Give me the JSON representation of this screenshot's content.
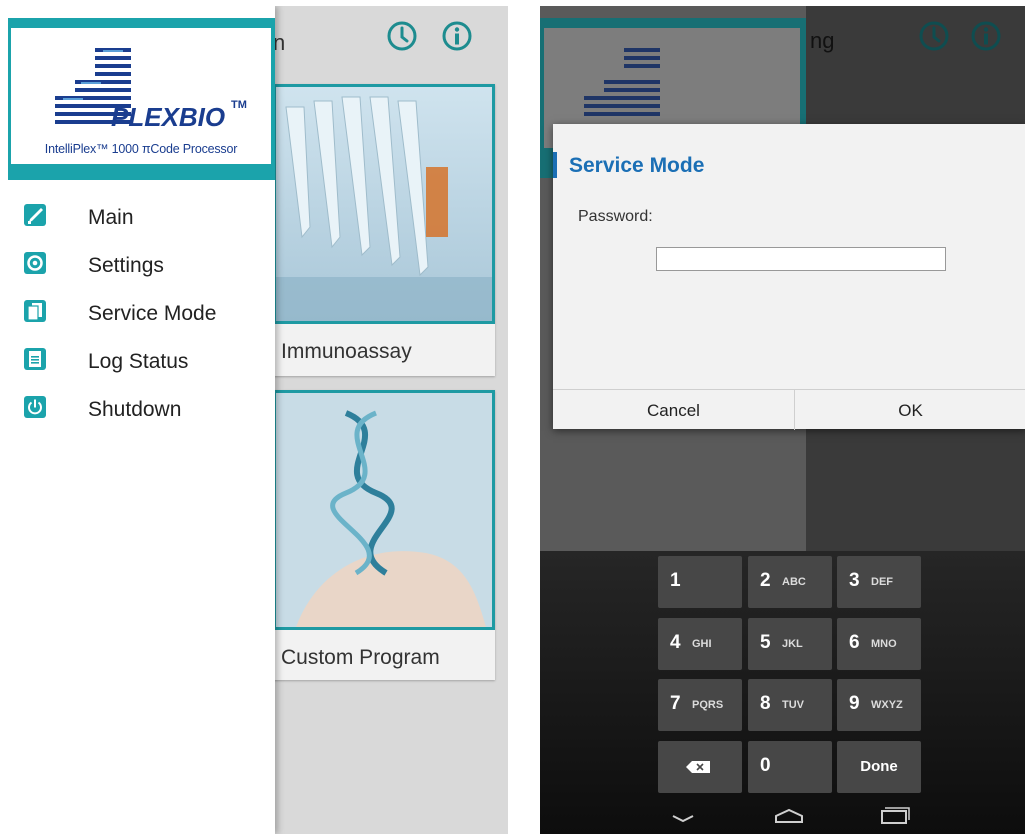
{
  "left": {
    "topbar_partial_title": "n",
    "logo": {
      "brand": "PLEXBIO",
      "trademark": "TM",
      "tagline": "IntelliPlex™ 1000 πCode Processor"
    },
    "menu": [
      {
        "label": "Main",
        "icon": "pipette-icon"
      },
      {
        "label": "Settings",
        "icon": "gear-icon"
      },
      {
        "label": "Service Mode",
        "icon": "documents-icon"
      },
      {
        "label": "Log Status",
        "icon": "document-icon"
      },
      {
        "label": "Shutdown",
        "icon": "power-icon"
      }
    ],
    "cards": [
      {
        "caption": "Immunoassay"
      },
      {
        "caption": "Custom Program"
      }
    ]
  },
  "right": {
    "topbar_partial_title": "ng",
    "dialog": {
      "title": "Service Mode",
      "password_label": "Password:",
      "password_value": "",
      "cancel_label": "Cancel",
      "ok_label": "OK"
    },
    "keypad": {
      "keys": [
        {
          "num": "1",
          "sub": ""
        },
        {
          "num": "2",
          "sub": "ABC"
        },
        {
          "num": "3",
          "sub": "DEF"
        },
        {
          "num": "4",
          "sub": "GHI"
        },
        {
          "num": "5",
          "sub": "JKL"
        },
        {
          "num": "6",
          "sub": "MNO"
        },
        {
          "num": "7",
          "sub": "PQRS"
        },
        {
          "num": "8",
          "sub": "TUV"
        },
        {
          "num": "9",
          "sub": "WXYZ"
        },
        {
          "num": "",
          "sub": ""
        },
        {
          "num": "0",
          "sub": ""
        },
        {
          "num": "Done",
          "sub": ""
        }
      ]
    }
  },
  "colors": {
    "teal": "#1ba3ab",
    "dialog_title": "#1b6fb5",
    "logo_blue": "#1a3d8f"
  }
}
